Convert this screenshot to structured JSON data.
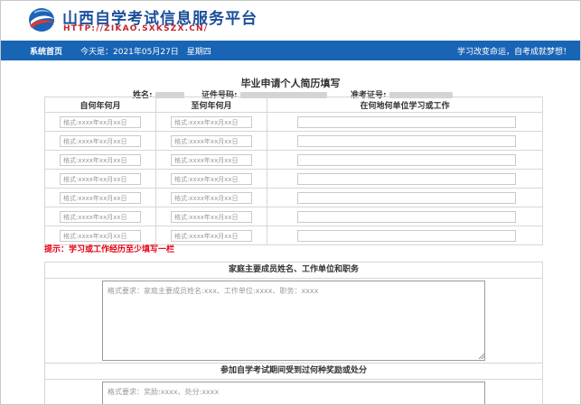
{
  "header": {
    "title": "山西自学考试信息服务平台",
    "url": "HTTP://ZIKAO.SXKSZX.CN/",
    "logo_icon": "globe-logo-icon"
  },
  "nav": {
    "home": "系统首页",
    "date": "今天是：2021年05月27日　星期四",
    "slogan": "学习改变命运，自考成就梦想！"
  },
  "form": {
    "title": "毕业申请个人简历填写",
    "name_label": "姓名:",
    "id_label": "证件号码:",
    "exam_label": "准考证号:"
  },
  "resume_table": {
    "headers": [
      "自何年何月",
      "至何年何月",
      "在何地何单位学习或工作"
    ],
    "date_placeholder": "格式:xxxx年xx月xx日",
    "row_count": 7
  },
  "tip": "提示：学习或工作经历至少填写一栏",
  "family_section": {
    "title": "家庭主要成员姓名、工作单位和职务",
    "placeholder": "格式要求：家庭主要成员姓名:xxx、工作单位:xxxx、职务：xxxx"
  },
  "awards_section": {
    "title": "参加自学考试期间受到过何种奖励或处分",
    "placeholder": "格式要求：奖励:xxxx、处分:xxxx"
  }
}
